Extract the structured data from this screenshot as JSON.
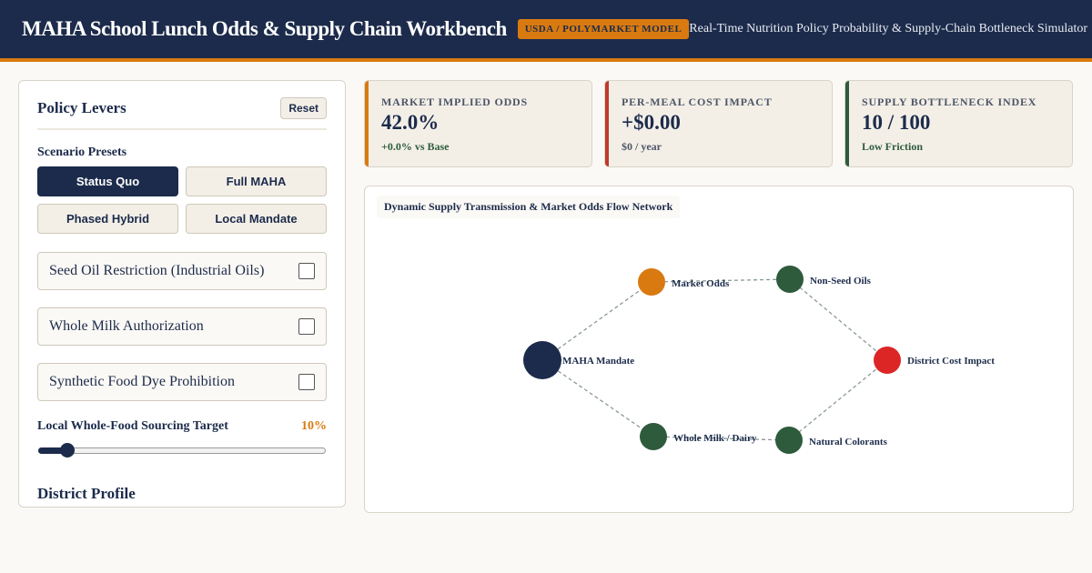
{
  "header": {
    "title": "MAHA School Lunch Odds & Supply Chain Workbench",
    "badge": "USDA / POLYMARKET MODEL",
    "subtitle": "Real-Time Nutrition Policy Probability & Supply-Chain Bottleneck Simulator"
  },
  "panel": {
    "title": "Policy Levers",
    "reset_label": "Reset",
    "presets_label": "Scenario Presets",
    "presets": [
      "Status Quo",
      "Full MAHA",
      "Phased Hybrid",
      "Local Mandate"
    ],
    "active_preset": "Status Quo",
    "toggles": [
      {
        "label": "Seed Oil Restriction (Industrial Oils)",
        "checked": false
      },
      {
        "label": "Whole Milk Authorization",
        "checked": false
      },
      {
        "label": "Synthetic Food Dye Prohibition",
        "checked": false
      }
    ],
    "slider": {
      "label": "Local Whole-Food Sourcing Target",
      "value_text": "10%",
      "value": 0.1
    },
    "district_label": "District Profile"
  },
  "cards": [
    {
      "label": "MARKET IMPLIED ODDS",
      "value": "42.0%",
      "sub": "+0.0% vs Base",
      "accent": "#d97a10",
      "sub_color": "#2e5b3c"
    },
    {
      "label": "PER-MEAL COST IMPACT",
      "value": "+$0.00",
      "sub": "$0 / year",
      "accent": "#c0392b",
      "sub_color": "#4d5566"
    },
    {
      "label": "SUPPLY BOTTLENECK INDEX",
      "value": "10 / 100",
      "sub": "Low Friction",
      "accent": "#2e5b3c",
      "sub_color": "#2e5b3c"
    }
  ],
  "network": {
    "title": "Dynamic Supply Transmission & Market Odds Flow Network",
    "colors": {
      "mandate": "#1c2b4b",
      "odds": "#d97a10",
      "supply": "#2e5b3c",
      "impact": "#dc2626",
      "edge": "#8a9a94"
    },
    "nodes": [
      {
        "id": "mandate",
        "label": "MAHA Mandate",
        "color": "#1c2b4b"
      },
      {
        "id": "odds",
        "label": "Market Odds",
        "color": "#d97a10"
      },
      {
        "id": "oils",
        "label": "Non-Seed Oils",
        "color": "#2e5b3c"
      },
      {
        "id": "milk",
        "label": "Whole Milk / Dairy",
        "color": "#2e5b3c"
      },
      {
        "id": "colorants",
        "label": "Natural Colorants",
        "color": "#2e5b3c"
      },
      {
        "id": "impact",
        "label": "District Cost Impact",
        "color": "#dc2626"
      }
    ],
    "edges": [
      [
        "mandate",
        "odds"
      ],
      [
        "mandate",
        "milk"
      ],
      [
        "odds",
        "oils"
      ],
      [
        "milk",
        "colorants"
      ],
      [
        "oils",
        "impact"
      ],
      [
        "colorants",
        "impact"
      ]
    ]
  }
}
